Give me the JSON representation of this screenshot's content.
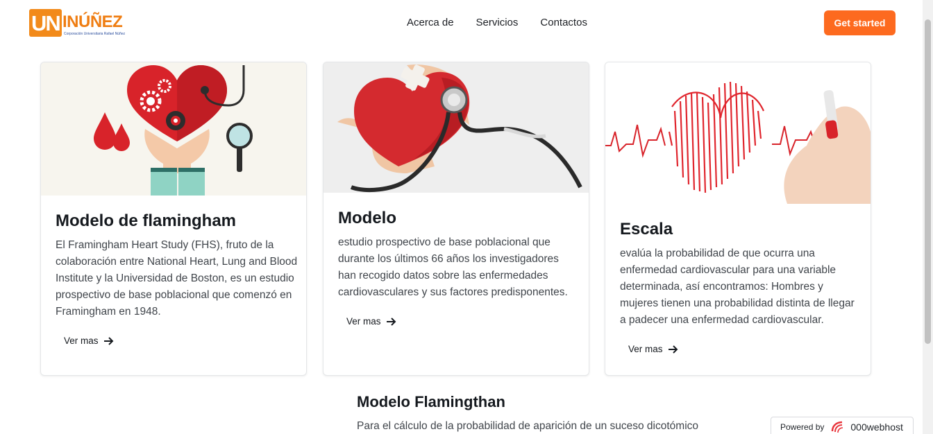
{
  "brand": {
    "logo_mark": "UN",
    "logo_word": "INÚÑEZ",
    "logo_tagline": "Corporación Universitaria Rafael Núñez"
  },
  "nav": {
    "items": [
      "Acerca de",
      "Servicios",
      "Contactos"
    ],
    "cta_label": "Get started"
  },
  "cards": [
    {
      "title": "Modelo de flamingham",
      "description": "El Framingham Heart Study (FHS), fruto de la colaboración entre National Heart, Lung and Blood Institute y la Universidad de Boston, es un estudio prospectivo de base poblacional que comenzó en Framingham en 1948.",
      "link_label": "Ver mas",
      "image_icon": "heart-gears-illustration"
    },
    {
      "title": "Modelo",
      "description": "estudio prospectivo de base poblacional que durante los últimos 66 años los investigadores han recogido datos sobre las enfermedades cardiovasculares y sus factores predisponentes.",
      "link_label": "Ver mas",
      "image_icon": "heart-stethoscope-photo"
    },
    {
      "title": "Escala",
      "description": "evalúa la probabilidad de que ocurra una enfermedad cardiovascular para una variable determinada, así encontramos: Hombres y mujeres tienen una probabilidad distinta de llegar a padecer una enfermedad cardiovascular.",
      "link_label": "Ver mas",
      "image_icon": "heartbeat-drawing"
    }
  ],
  "section": {
    "title": "Modelo Flamingthan",
    "text": "Para el cálculo de la probabilidad de aparición de un suceso dicotómico"
  },
  "badge": {
    "powered_label": "Powered by",
    "brand_label": "000webhost"
  },
  "colors": {
    "accent": "#fd6a1f",
    "logo_orange": "#f28a1a",
    "heart_red": "#d8232a"
  }
}
